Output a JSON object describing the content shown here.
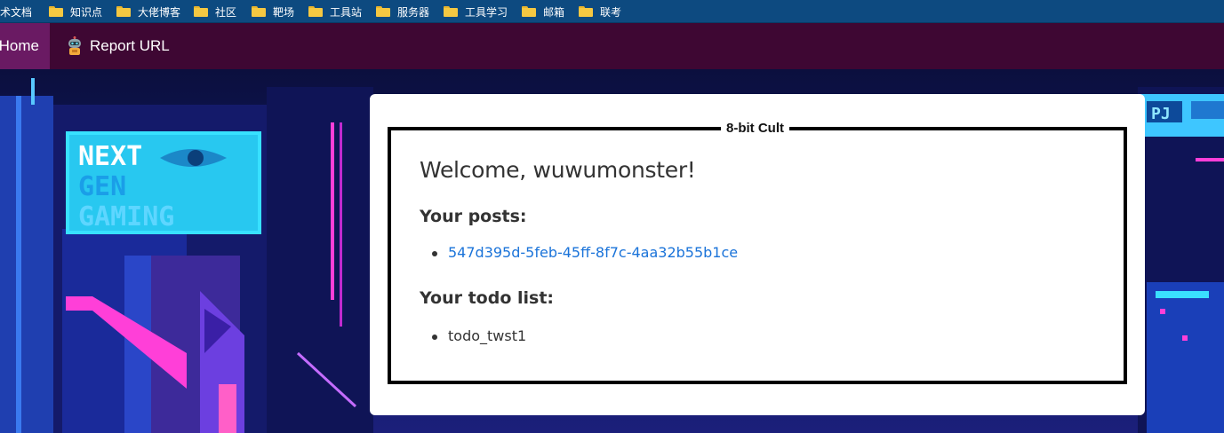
{
  "bookmarks": [
    {
      "label": "技术文档",
      "icon": "folder-icon"
    },
    {
      "label": "知识点",
      "icon": "folder-icon"
    },
    {
      "label": "大佬博客",
      "icon": "folder-icon"
    },
    {
      "label": "社区",
      "icon": "folder-icon"
    },
    {
      "label": "靶场",
      "icon": "folder-icon"
    },
    {
      "label": "工具站",
      "icon": "folder-icon"
    },
    {
      "label": "服务器",
      "icon": "folder-icon"
    },
    {
      "label": "工具学习",
      "icon": "folder-icon"
    },
    {
      "label": "邮箱",
      "icon": "folder-icon"
    },
    {
      "label": "联考",
      "icon": "folder-icon"
    }
  ],
  "nav": {
    "home_label": "Home",
    "report_label": "Report URL",
    "report_icon": "robot-icon"
  },
  "card": {
    "legend": "8-bit Cult",
    "welcome": "Welcome, wuwumonster!",
    "posts_heading": "Your posts:",
    "posts": [
      "547d395d-5feb-45ff-8f7c-4aa32b55b1ce"
    ],
    "todo_heading": "Your todo list:",
    "todos": [
      "todo_twst1"
    ]
  },
  "background": {
    "sign_lines": [
      "NEXT",
      "GEN",
      "GAMING"
    ],
    "badge": "PJ"
  },
  "colors": {
    "bookmark_bar": "#0d4a80",
    "navbar": "#3e0733",
    "nav_active": "#6a1a63",
    "link": "#1a73d9"
  }
}
